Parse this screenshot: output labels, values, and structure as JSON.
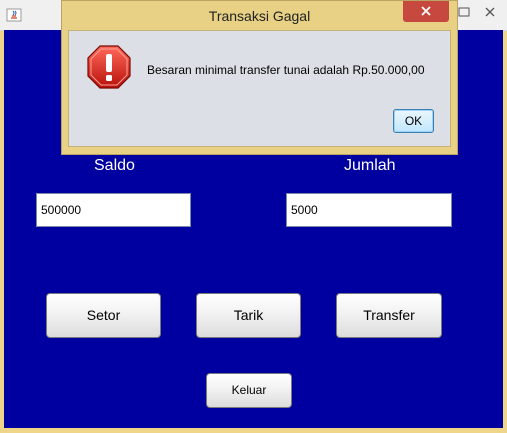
{
  "main": {
    "saldo_label": "Saldo",
    "jumlah_label": "Jumlah",
    "saldo_value": "500000",
    "jumlah_value": "5000",
    "buttons": {
      "setor": "Setor",
      "tarik": "Tarik",
      "transfer": "Transfer",
      "keluar": "Keluar"
    },
    "colors": {
      "content_bg": "#0000a0"
    }
  },
  "dialog": {
    "title": "Transaksi Gagal",
    "message": "Besaran minimal transfer tunai adalah Rp.50.000,00",
    "ok_label": "OK",
    "icon": "error-octagon-icon",
    "colors": {
      "frame": "#e8d184",
      "close": "#c7483f"
    }
  }
}
